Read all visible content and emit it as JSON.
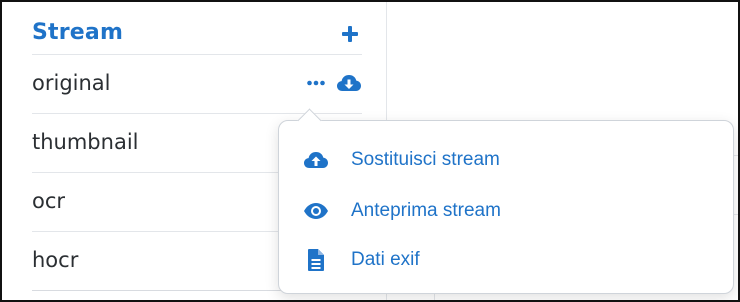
{
  "colors": {
    "accent": "#1f73c8",
    "text": "#2b2f33",
    "border": "#e3e6ea"
  },
  "panel": {
    "title": "Stream",
    "add_icon": "plus-icon",
    "streams": [
      {
        "name": "original",
        "actions": [
          "more-options-icon",
          "cloud-download-icon"
        ]
      },
      {
        "name": "thumbnail"
      },
      {
        "name": "ocr"
      },
      {
        "name": "hocr"
      }
    ]
  },
  "context_menu": {
    "items": [
      {
        "icon": "cloud-upload-icon",
        "label": "Sostituisci stream"
      },
      {
        "icon": "eye-icon",
        "label": "Anteprima stream"
      },
      {
        "icon": "file-icon",
        "label": "Dati exif"
      }
    ]
  }
}
